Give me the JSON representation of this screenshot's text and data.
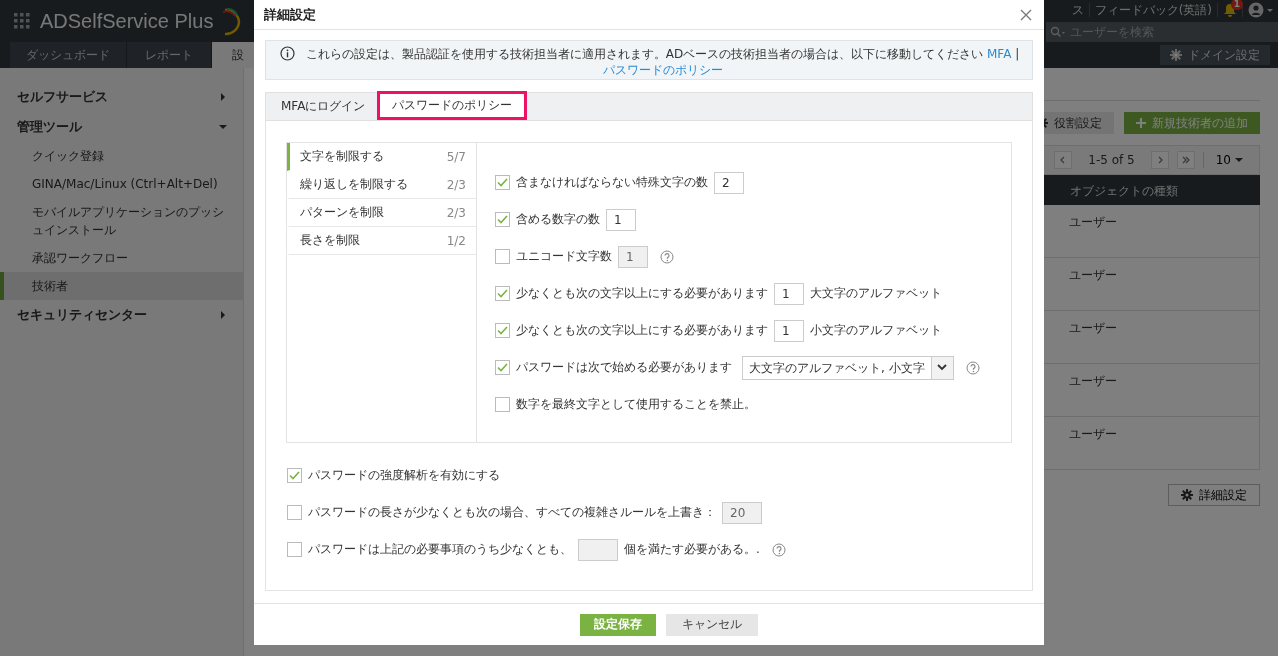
{
  "app": {
    "logo": "ADSelfService Plus",
    "top_links": [
      {
        "label": "ス"
      },
      {
        "label": "フィードバック(英語)"
      }
    ],
    "notification_count": "1",
    "search": {
      "placeholder": "ユーザーを検索"
    },
    "nav_tabs": [
      {
        "label": "ダッシュボード",
        "selected": false
      },
      {
        "label": "レポート",
        "selected": false
      },
      {
        "label": "設",
        "selected": true
      }
    ],
    "domain_button": "ドメイン設定"
  },
  "sidebar": {
    "sections": [
      {
        "label": "セルフサービス",
        "expanded": false
      },
      {
        "label": "管理ツール",
        "expanded": true,
        "children": [
          {
            "label": "クイック登録",
            "selected": false
          },
          {
            "label": "GINA/Mac/Linux (Ctrl+Alt+Del)",
            "selected": false
          },
          {
            "label": "モバイルアプリケーションのプッシュインストール",
            "selected": false
          },
          {
            "label": "承認ワークフロー",
            "selected": false
          },
          {
            "label": "技術者",
            "selected": true
          }
        ]
      },
      {
        "label": "セキュリティセンター",
        "expanded": false
      }
    ]
  },
  "content": {
    "role_button": "役割設定",
    "add_button": "新規技術者の追加",
    "pagination": {
      "range": "1-5 of 5",
      "page_size": "10"
    },
    "table": {
      "columns": [
        "オブジェクトの種類"
      ],
      "rows": [
        [
          "ユーザー"
        ],
        [
          "ユーザー"
        ],
        [
          "ユーザー"
        ],
        [
          "ユーザー"
        ],
        [
          "ユーザー"
        ]
      ]
    },
    "advanced_button": "詳細設定"
  },
  "dialog": {
    "title": "詳細設定",
    "info": {
      "text": "これらの設定は、製品認証を使用する技術担当者に適用されます。ADベースの技術担当者の場合は、以下に移動してください",
      "links": [
        "MFA",
        "パスワードのポリシー"
      ],
      "separator": "|"
    },
    "tabs": [
      {
        "label": "MFAにログイン",
        "selected": false
      },
      {
        "label": "パスワードのポリシー",
        "selected": true
      }
    ],
    "categories": [
      {
        "label": "文字を制限する",
        "count": "5/7",
        "selected": true
      },
      {
        "label": "繰り返しを制限する",
        "count": "2/3",
        "selected": false
      },
      {
        "label": "パターンを制限",
        "count": "2/3",
        "selected": false
      },
      {
        "label": "長さを制限",
        "count": "1/2",
        "selected": false
      }
    ],
    "options": [
      {
        "kind": "number",
        "checked": true,
        "label": "含まなければならない特殊文字の数",
        "value": "2",
        "disabled": false,
        "help": false
      },
      {
        "kind": "number",
        "checked": true,
        "label": "含める数字の数",
        "value": "1",
        "disabled": false,
        "help": false
      },
      {
        "kind": "number",
        "checked": false,
        "label": "ユニコード文字数",
        "value": "1",
        "disabled": true,
        "help": true
      },
      {
        "kind": "number",
        "checked": true,
        "label": "少なくとも次の文字以上にする必要があります",
        "value": "1",
        "disabled": false,
        "suffix": "大文字のアルファベット",
        "help": false
      },
      {
        "kind": "number",
        "checked": true,
        "label": "少なくとも次の文字以上にする必要があります",
        "value": "1",
        "disabled": false,
        "suffix": "小文字のアルファベット",
        "help": false
      },
      {
        "kind": "select",
        "checked": true,
        "label": "パスワードは次で始める必要があります",
        "value": "大文字のアルファベット, 小文字",
        "help": true
      },
      {
        "kind": "plain",
        "checked": false,
        "label": "数字を最終文字として使用することを禁止。",
        "help": false
      }
    ],
    "general_options": [
      {
        "kind": "plain",
        "checked": true,
        "label": "パスワードの強度解析を有効にする",
        "help": false
      },
      {
        "kind": "number",
        "checked": false,
        "label": "パスワードの長さが少なくとも次の場合、すべての複雑さルールを上書き：",
        "value": "20",
        "disabled": true,
        "help": false
      },
      {
        "kind": "number",
        "checked": false,
        "label": "パスワードは上記の必要事項のうち少なくとも、",
        "disabled": true,
        "suffix": "個を満たす必要がある。.",
        "help": true
      }
    ],
    "save_button": "設定保存",
    "cancel_button": "キャンセル"
  }
}
